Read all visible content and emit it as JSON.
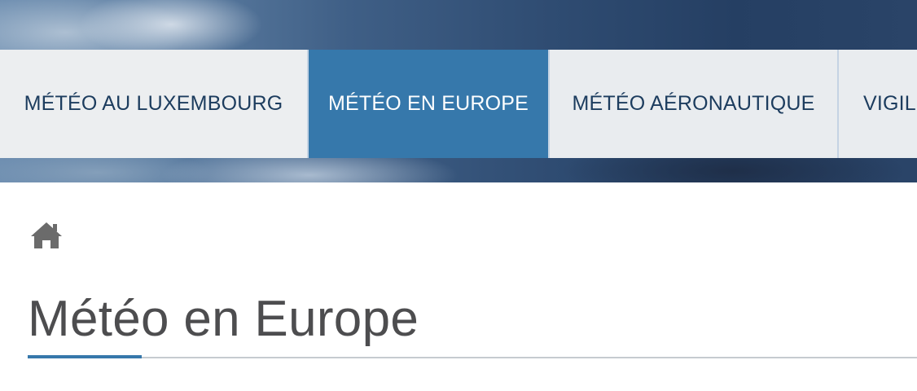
{
  "nav": {
    "items": [
      {
        "label": "MÉTÉO AU LUXEMBOURG",
        "active": false
      },
      {
        "label": "MÉTÉO EN EUROPE",
        "active": true
      },
      {
        "label": "MÉTÉO AÉRONAUTIQUE",
        "active": false
      },
      {
        "label": "VIGIL",
        "active": false
      }
    ]
  },
  "breadcrumb": {
    "icon": "home-icon"
  },
  "page": {
    "title": "Météo en Europe"
  },
  "colors": {
    "accent": "#3678ab",
    "nav_text": "#1c3c5e",
    "nav_bg": "#e9ecef",
    "title_text": "#4d4d4f"
  }
}
